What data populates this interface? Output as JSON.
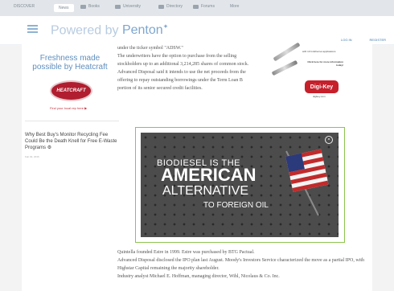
{
  "topnav": {
    "items": [
      {
        "label": "DISCOVER"
      },
      {
        "label": "News",
        "icon": "news-icon"
      },
      {
        "label": "Books",
        "icon": "book-icon"
      },
      {
        "label": "University",
        "icon": "graduation-cap-icon"
      },
      {
        "label": "Directory",
        "icon": "directory-icon"
      },
      {
        "label": "Forums",
        "icon": "forum-icon"
      },
      {
        "label": "More"
      }
    ]
  },
  "header": {
    "powered_text": "Powered by",
    "brand": "Penton",
    "login": "LOG IN",
    "register": "REGISTER"
  },
  "sidebar": {
    "ad_title": "Freshness made possible by Heatcraft",
    "heatcraft_logo": "HEATCRAFT",
    "dealer_link": "Find your local rep here",
    "story_title": "Why Best Buy's Monitor Recycling Fee Could Be the Death Knell for Free E-Waste Programs",
    "story_date": "Feb 02, 2016"
  },
  "article": {
    "p1": "under the ticker symbol \"ADSW.\"",
    "p2": "The underwriters have the option to purchase from the selling stockholders up to an additional 3,214,285 shares of common stock.",
    "p3": "Advanced Disposal said it intends to use the net proceeds from the offering to repay outstanding borrowings under the Term Loan B portion of its senior secured credit facilities."
  },
  "ad_right": {
    "top_text": "with 10 G Ethernet applications",
    "cta": "Click here for more information today!",
    "logo": "Digi-Key",
    "url": "digikey.com"
  },
  "video": {
    "line1": "BIODIESEL IS THE",
    "line2": "AMERICAN",
    "line3": "ALTERNATIVE",
    "line4": "TO FOREIGN OIL",
    "close": "×"
  },
  "article2": {
    "p1": "Quintella founded Estre in 1999. Estre was purchased by BTG Pactual.",
    "p2": "Advanced Disposal disclosed the IPO plan last August. Moody's Investors Service characterized the move as a partial IPO, with Highstar Capital remaining the majority shareholder.",
    "p3": "Industry analyst Michael E. Hoffman, managing director, Wihl, Nicolaus & Co. Inc."
  }
}
